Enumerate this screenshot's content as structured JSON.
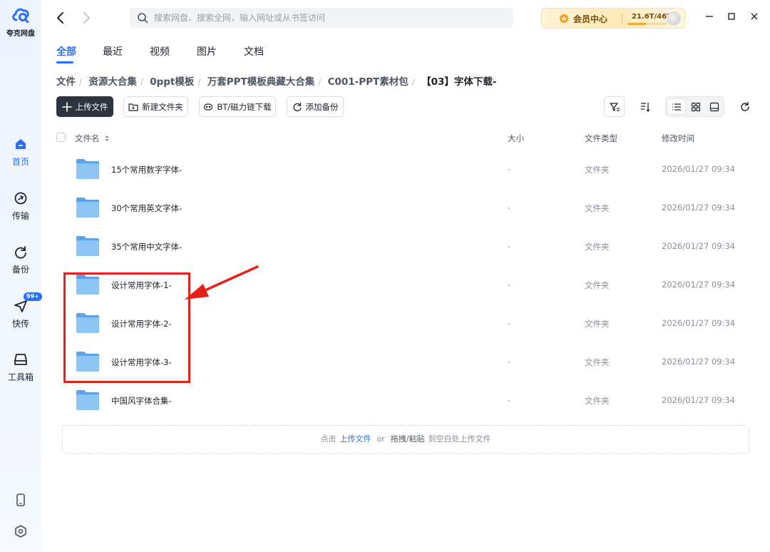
{
  "app": {
    "logo_text": "夸克网盘"
  },
  "sidebar": {
    "items": [
      {
        "label": "首页",
        "icon": "home-icon",
        "active": true
      },
      {
        "label": "传输",
        "icon": "transfer-icon"
      },
      {
        "label": "备份",
        "icon": "backup-icon"
      },
      {
        "label": "快传",
        "icon": "send-icon",
        "badge": "99+"
      },
      {
        "label": "工具箱",
        "icon": "toolbox-icon"
      }
    ],
    "bottom_icons": [
      "phone-icon",
      "settings-icon"
    ]
  },
  "search": {
    "placeholder": "搜索网盘、搜索全网，输入网址或从书签访问"
  },
  "vip": {
    "label": "会员中心",
    "quota": "21.6T/46T",
    "quota_fraction": 0.47
  },
  "tabs": [
    {
      "label": "全部",
      "active": true
    },
    {
      "label": "最近"
    },
    {
      "label": "视频"
    },
    {
      "label": "图片"
    },
    {
      "label": "文档"
    }
  ],
  "breadcrumb": [
    "文件",
    "资源大合集",
    "0ppt模板",
    "万套PPT模板典藏大合集",
    "C001-PPT素材包",
    "【03】字体下载-"
  ],
  "toolbar": {
    "upload": "上传文件",
    "new_folder": "新建文件夹",
    "bt_download": "BT/磁力链下载",
    "add_backup": "添加备份"
  },
  "table": {
    "columns": {
      "name": "文件名",
      "size": "大小",
      "type": "文件类型",
      "modified": "修改时间"
    },
    "rows": [
      {
        "name": "15个常用数字字体-",
        "size": "-",
        "type": "文件夹",
        "modified": "2026/01/27 09:34"
      },
      {
        "name": "30个常用英文字体-",
        "size": "-",
        "type": "文件夹",
        "modified": "2026/01/27 09:34"
      },
      {
        "name": "35个常用中文字体-",
        "size": "-",
        "type": "文件夹",
        "modified": "2026/01/27 09:34"
      },
      {
        "name": "设计常用字体-1-",
        "size": "-",
        "type": "文件夹",
        "modified": "2026/01/27 09:34"
      },
      {
        "name": "设计常用字体-2-",
        "size": "-",
        "type": "文件夹",
        "modified": "2026/01/27 09:34"
      },
      {
        "name": "设计常用字体-3-",
        "size": "-",
        "type": "文件夹",
        "modified": "2026/01/27 09:34"
      },
      {
        "name": "中国风字体合集-",
        "size": "-",
        "type": "文件夹",
        "modified": "2026/01/27 09:34"
      }
    ]
  },
  "dropzone": {
    "prefix": "点击",
    "upload_link": "上传文件",
    "or": "or",
    "paste": "拖拽/粘贴",
    "suffix": "到空白处上传文件"
  },
  "colors": {
    "accent": "#2a6ff6",
    "annotation": "#e8201a",
    "folder": "#7ab8f0"
  }
}
